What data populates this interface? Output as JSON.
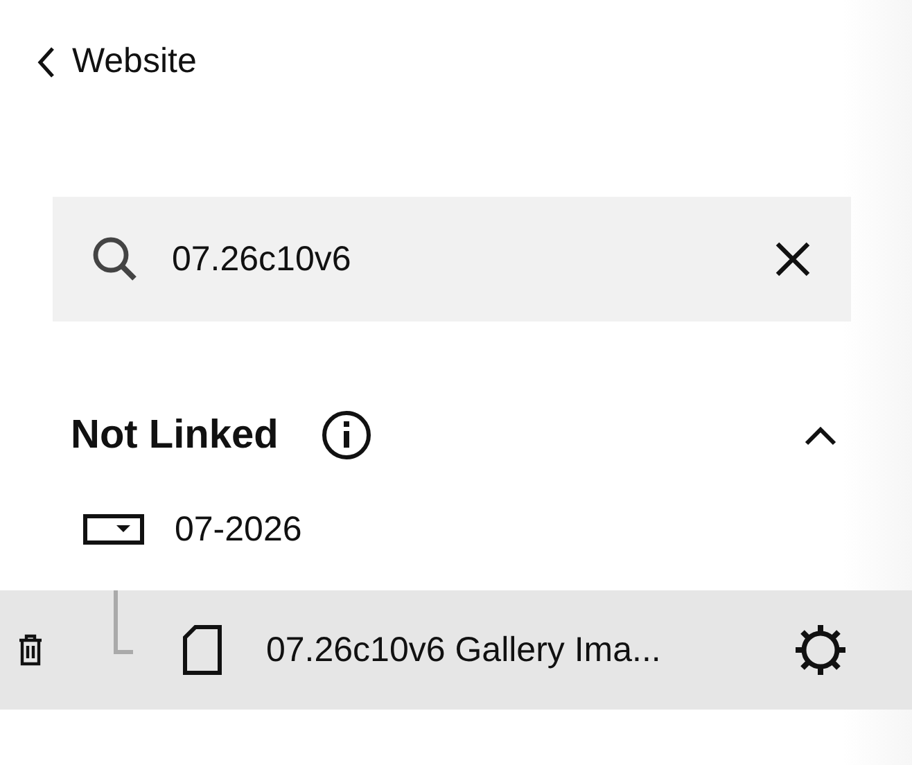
{
  "back": {
    "label": "Website"
  },
  "search": {
    "value": "07.26c10v6"
  },
  "section": {
    "title": "Not Linked",
    "expanded": true,
    "items": [
      {
        "kind": "folder",
        "label": "07-2026",
        "selected": false,
        "children": [
          {
            "kind": "page",
            "label": "07.26c10v6 Gallery Ima...",
            "selected": true
          }
        ]
      }
    ]
  }
}
